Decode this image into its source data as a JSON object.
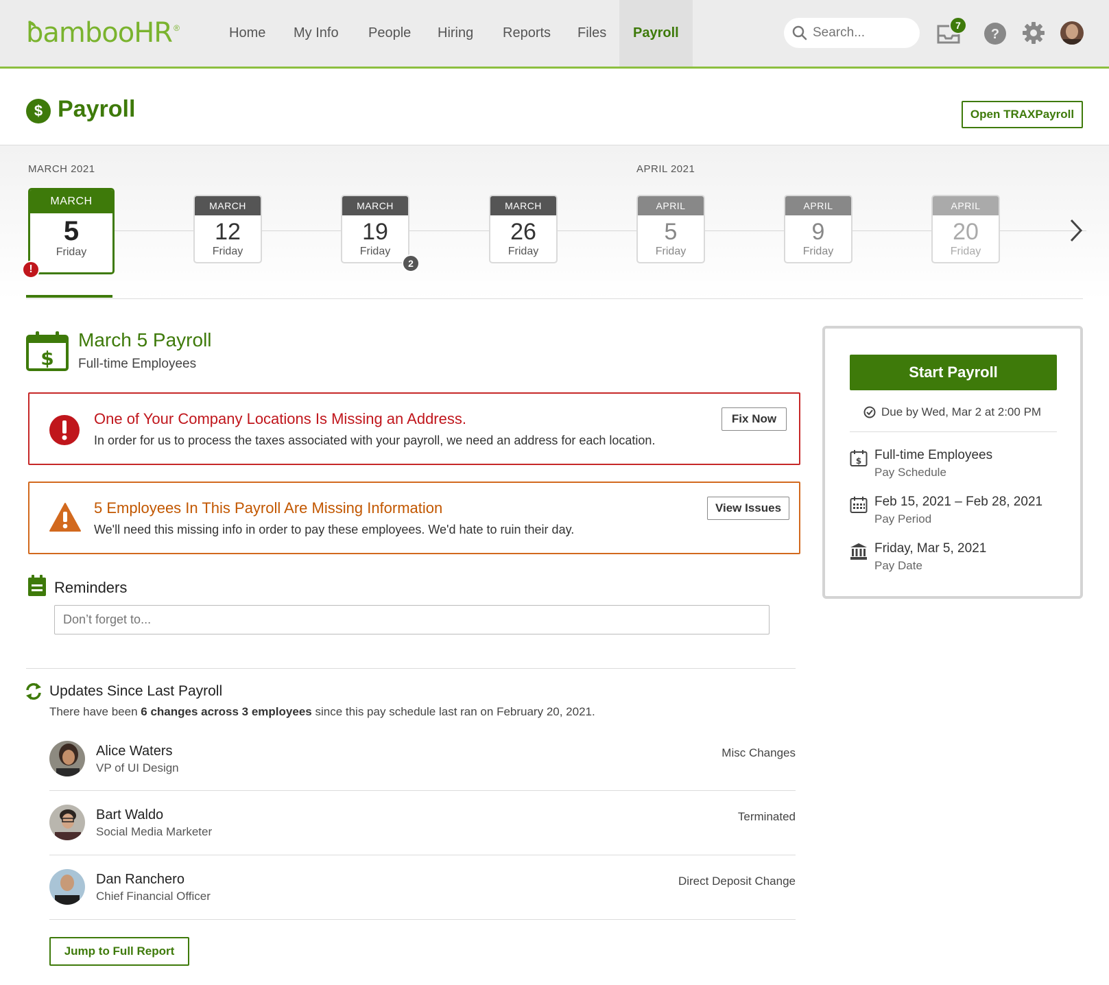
{
  "brand": {
    "name": "bambooHR",
    "reg": "®",
    "accent": "#3e7a0a",
    "logo_green": "#7ab32e"
  },
  "nav": {
    "items": [
      {
        "label": "Home"
      },
      {
        "label": "My Info"
      },
      {
        "label": "People"
      },
      {
        "label": "Hiring"
      },
      {
        "label": "Reports"
      },
      {
        "label": "Files"
      },
      {
        "label": "Payroll",
        "active": true
      }
    ],
    "search_placeholder": "Search...",
    "notification_count": "7",
    "icons": [
      "search-icon",
      "inbox-icon",
      "help-icon",
      "gear-icon",
      "avatar"
    ]
  },
  "page": {
    "title": "Payroll",
    "title_icon": "$",
    "open_trax_label": "Open TRAXPayroll"
  },
  "calendar": {
    "months": [
      "MARCH 2021",
      "APRIL 2021"
    ],
    "dates": [
      {
        "month": "MARCH",
        "day": "5",
        "weekday": "Friday",
        "state": "active",
        "error": "!"
      },
      {
        "month": "MARCH",
        "day": "12",
        "weekday": "Friday",
        "state": "dark"
      },
      {
        "month": "MARCH",
        "day": "19",
        "weekday": "Friday",
        "state": "dark",
        "count": "2"
      },
      {
        "month": "MARCH",
        "day": "26",
        "weekday": "Friday",
        "state": "dark"
      },
      {
        "month": "APRIL",
        "day": "5",
        "weekday": "Friday",
        "state": "light"
      },
      {
        "month": "APRIL",
        "day": "9",
        "weekday": "Friday",
        "state": "light"
      },
      {
        "month": "APRIL",
        "day": "20",
        "weekday": "Friday",
        "state": "lighter"
      }
    ]
  },
  "payroll": {
    "title": "March 5 Payroll",
    "subtitle": "Full-time Employees",
    "dollar": "$"
  },
  "alerts": [
    {
      "type": "error",
      "icon": "!",
      "title": "One of Your Company Locations Is Missing an Address.",
      "body": "In order for us to process the taxes associated with your payroll, we need an address for each location.",
      "action": "Fix Now"
    },
    {
      "type": "warning",
      "icon": "!",
      "title": "5 Employees In This Payroll Are Missing Information",
      "body": "We'll need this missing info in order to pay these employees. We'd hate to ruin their day.",
      "action": "View Issues"
    }
  ],
  "reminders": {
    "title": "Reminders",
    "placeholder": "Don’t forget to..."
  },
  "updates": {
    "title": "Updates Since Last Payroll",
    "text_pre": "There have been ",
    "text_bold1": "6 changes across 3 employees",
    "text_post": " since this pay schedule last ran on February 20, 2021.",
    "employees": [
      {
        "name": "Alice Waters",
        "role": "VP of UI Design",
        "change": "Misc Changes"
      },
      {
        "name": "Bart Waldo",
        "role": "Social Media Marketer",
        "change": "Terminated"
      },
      {
        "name": "Dan Ranchero",
        "role": "Chief Financial Officer",
        "change": "Direct Deposit Change"
      }
    ],
    "report_button": "Jump to Full Report"
  },
  "side": {
    "start_label": "Start Payroll",
    "due": "Due by Wed, Mar 2 at 2:00 PM",
    "schedule": {
      "title": "Full-time Employees",
      "sub": "Pay Schedule"
    },
    "period": {
      "title": "Feb 15, 2021 – Feb 28, 2021",
      "sub": "Pay Period"
    },
    "paydate": {
      "title": "Friday, Mar 5, 2021",
      "sub": "Pay Date"
    }
  }
}
